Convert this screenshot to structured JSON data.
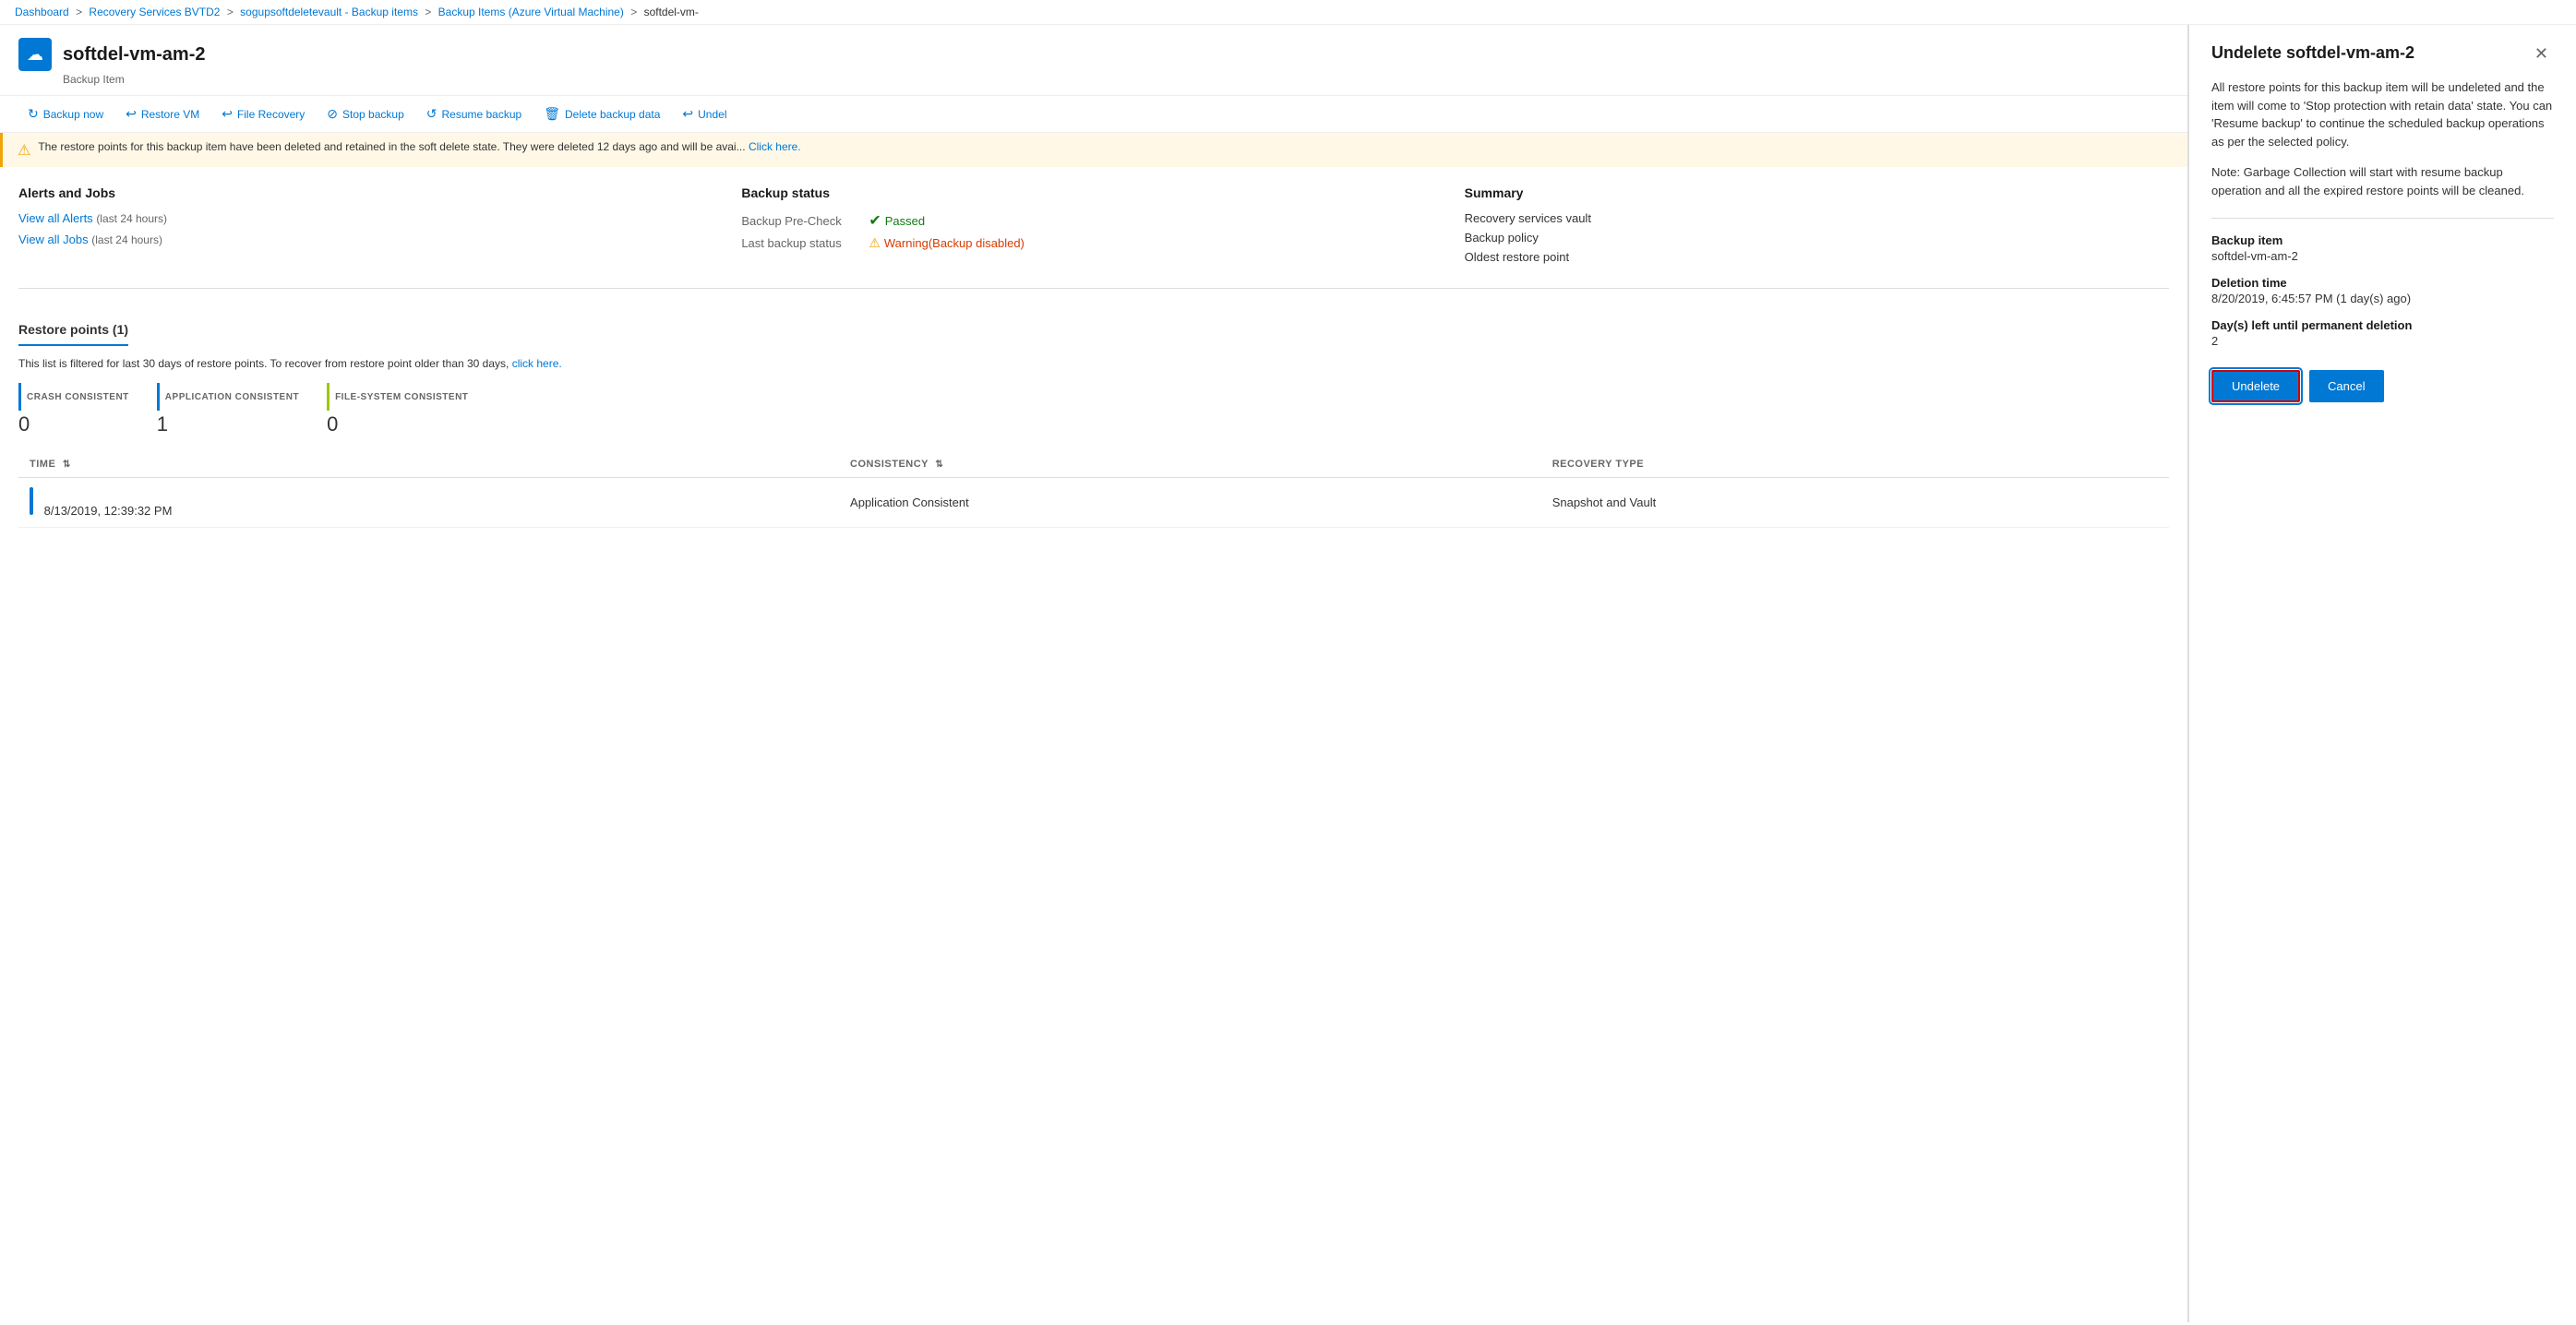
{
  "breadcrumb": {
    "items": [
      {
        "label": "Dashboard",
        "href": "#"
      },
      {
        "label": "Recovery Services BVTD2",
        "href": "#"
      },
      {
        "label": "sogupsoftdeletevault - Backup items",
        "href": "#"
      },
      {
        "label": "Backup Items (Azure Virtual Machine)",
        "href": "#"
      },
      {
        "label": "softdel-vm-",
        "href": "#"
      }
    ]
  },
  "header": {
    "vm_name": "softdel-vm-am-2",
    "subtitle": "Backup Item"
  },
  "toolbar": {
    "buttons": [
      {
        "id": "backup-now",
        "icon": "↻",
        "label": "Backup now"
      },
      {
        "id": "restore-vm",
        "icon": "↩",
        "label": "Restore VM"
      },
      {
        "id": "file-recovery",
        "icon": "↩",
        "label": "File Recovery"
      },
      {
        "id": "stop-backup",
        "icon": "⊘",
        "label": "Stop backup"
      },
      {
        "id": "resume-backup",
        "icon": "↺",
        "label": "Resume backup"
      },
      {
        "id": "delete-backup-data",
        "icon": "🗑",
        "label": "Delete backup data"
      },
      {
        "id": "undelete",
        "icon": "↩",
        "label": "Undel"
      }
    ]
  },
  "warning": {
    "message": "The restore points for this backup item have been deleted and retained in the soft delete state. They were deleted 12 days ago and will be avai...",
    "link_text": "Click here."
  },
  "alerts_jobs": {
    "title": "Alerts and Jobs",
    "view_alerts_label": "View all Alerts",
    "view_alerts_sub": "(last 24 hours)",
    "view_jobs_label": "View all Jobs",
    "view_jobs_sub": "(last 24 hours)"
  },
  "backup_status": {
    "title": "Backup status",
    "pre_check_label": "Backup Pre-Check",
    "pre_check_status": "Passed",
    "last_backup_label": "Last backup status",
    "last_backup_status": "Warning(Backup disabled)"
  },
  "summary": {
    "title": "Summary",
    "recovery_vault_label": "Recovery services vault",
    "backup_policy_label": "Backup policy",
    "oldest_restore_label": "Oldest restore point"
  },
  "restore_points": {
    "title": "Restore points (1)",
    "filter_text": "This list is filtered for last 30 days of restore points. To recover from restore point older than 30 days,",
    "filter_link": "click here.",
    "consistency_types": [
      {
        "color": "#0078d4",
        "label": "CRASH CONSISTENT",
        "count": "0"
      },
      {
        "color": "#0078d4",
        "label": "APPLICATION CONSISTENT",
        "count": "1"
      },
      {
        "color": "#9bc700",
        "label": "FILE-SYSTEM CONSISTENT",
        "count": "0"
      }
    ],
    "table": {
      "columns": [
        {
          "id": "time",
          "label": "TIME",
          "sortable": true
        },
        {
          "id": "consistency",
          "label": "CONSISTENCY",
          "sortable": true
        },
        {
          "id": "recovery_type",
          "label": "RECOVERY TYPE",
          "sortable": false
        }
      ],
      "rows": [
        {
          "time": "8/13/2019, 12:39:32 PM",
          "consistency": "Application Consistent",
          "recovery_type": "Snapshot and Vault"
        }
      ]
    }
  },
  "undelete_panel": {
    "title": "Undelete softdel-vm-am-2",
    "description": "All restore points for this backup item will be undeleted and the item will come to 'Stop protection with retain data' state. You can 'Resume backup' to continue the scheduled backup operations as per the selected policy.",
    "note": "Note: Garbage Collection will start with resume backup operation and all the expired restore points will be cleaned.",
    "backup_item_label": "Backup item",
    "backup_item_value": "softdel-vm-am-2",
    "deletion_time_label": "Deletion time",
    "deletion_time_value": "8/20/2019, 6:45:57 PM (1 day(s) ago)",
    "days_left_label": "Day(s) left until permanent deletion",
    "days_left_value": "2",
    "undelete_btn": "Undelete",
    "cancel_btn": "Cancel"
  }
}
